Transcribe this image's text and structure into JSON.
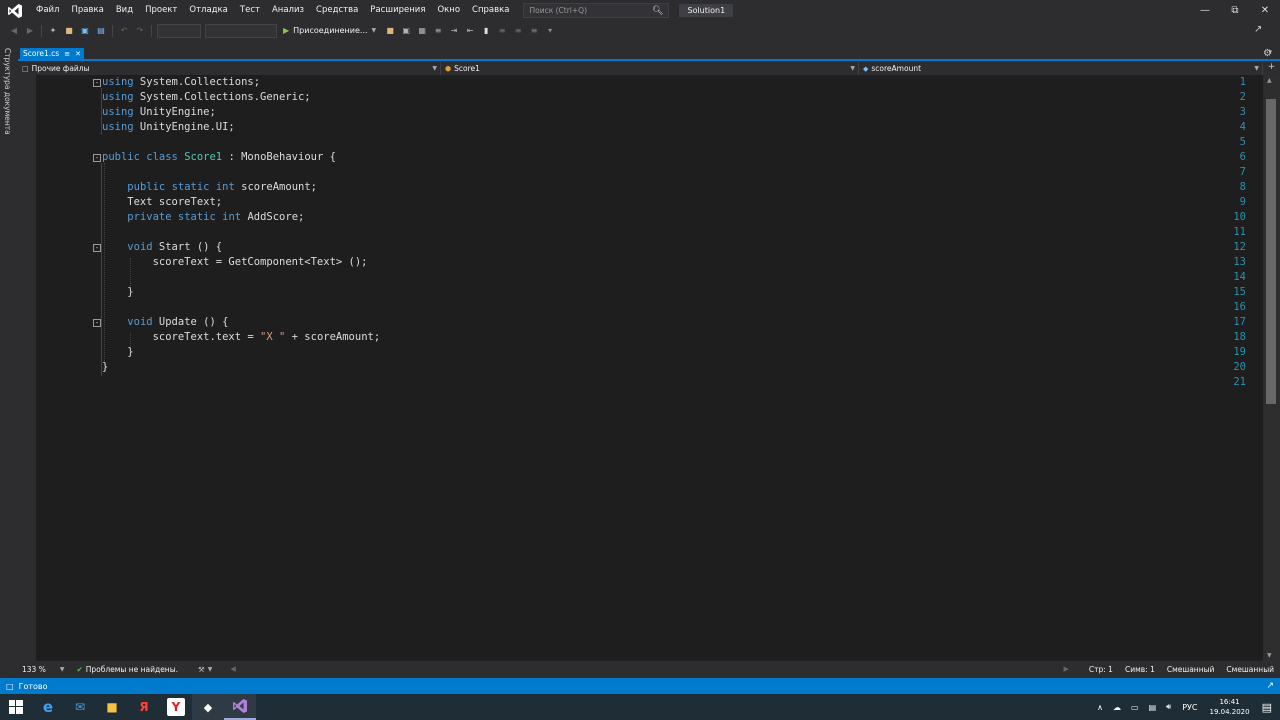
{
  "menu": [
    "Файл",
    "Правка",
    "Вид",
    "Проект",
    "Отладка",
    "Тест",
    "Анализ",
    "Средства",
    "Расширения",
    "Окно",
    "Справка"
  ],
  "search": {
    "placeholder": "Поиск (Ctrl+Q)"
  },
  "solution_name": "Solution1",
  "toolbar": {
    "run_label": "Присоединение..."
  },
  "left_panel_label": "Структура документа",
  "tab": {
    "label": "Score1.cs"
  },
  "nav": {
    "project": "Прочие файлы",
    "type": "Score1",
    "member": "scoreAmount"
  },
  "editor": {
    "line_numbers": [
      "1",
      "2",
      "3",
      "4",
      "5",
      "6",
      "7",
      "8",
      "9",
      "10",
      "11",
      "12",
      "13",
      "14",
      "15",
      "16",
      "17",
      "18",
      "19",
      "20",
      "21"
    ]
  },
  "status": {
    "zoom": "133 %",
    "problems": "Проблемы не найдены.",
    "line": "Стр: 1",
    "col": "Симв: 1",
    "mixed1": "Смешанный",
    "mixed2": "Смешанный",
    "ready": "Готово"
  },
  "taskbar": {
    "lang": "РУС",
    "time": "16:41",
    "date": "19.04.2020"
  },
  "colors": {
    "accent": "#007acc",
    "keyword": "#569cd6",
    "type": "#4ec9b0",
    "string": "#d69d85",
    "line_number": "#2b91af"
  }
}
